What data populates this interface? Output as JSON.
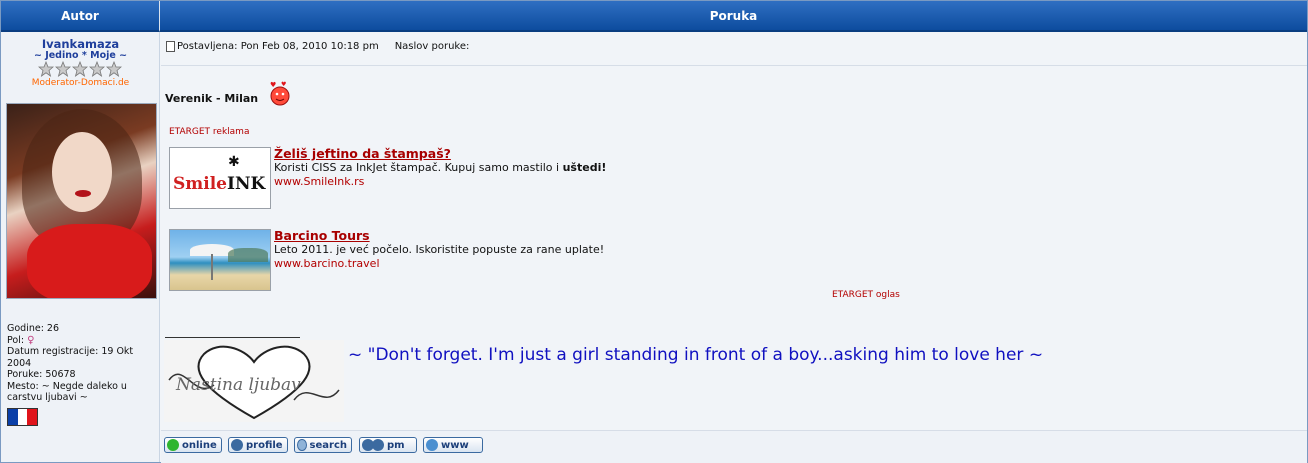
{
  "header": {
    "col_author": "Autor",
    "col_message": "Poruka"
  },
  "author": {
    "name": "Ivankamaza",
    "title": "~ Jedino * Moje ~",
    "rank": "Moderator-Domaci.de",
    "info": {
      "godine": "Godine: 26",
      "pol": "Pol:",
      "datum": "Datum registracije: 19 Okt 2004",
      "poruke": "Poruke: 50678",
      "mesto": "Mesto: ~ Negde daleko u carstvu ljubavi ~"
    },
    "flag_colors": [
      "#0a3fa8",
      "#ffffff",
      "#e0141b"
    ]
  },
  "post": {
    "posted_label": "Postavljena: Pon Feb 08, 2010 10:18 pm",
    "subject_label": "Naslov poruke:",
    "text": "Verenik - Milan",
    "etarget_label": "ETARGET reklama",
    "ads": [
      {
        "title": "Želiš jeftino da štampaš?",
        "desc_before": "Koristi CISS za InkJet štampač. Kupuj samo mastilo i ",
        "desc_bold": "uštedi!",
        "url": "www.SmileInk.rs",
        "img_text_a": "Smile",
        "img_text_b": "INK"
      },
      {
        "title": "Barcino Tours",
        "desc_before": "Leto 2011. je već počelo. Iskoristite popuste za rane uplate!",
        "desc_bold": "",
        "url": "www.barcino.travel"
      }
    ],
    "etarget_oglas": "ETARGET oglas",
    "signature_img_text": "Nastina ljubav",
    "signature_quote": "~ \"Don't forget. I'm just a girl standing in front of a boy...asking him to love her ~"
  },
  "buttons": {
    "online": "online",
    "profile": "profile",
    "search": "search",
    "pm": "pm",
    "www": "www"
  },
  "colors": {
    "header_blue": "#0d4c9e",
    "ad_red": "#a80000",
    "quote_blue": "#1010c0"
  }
}
